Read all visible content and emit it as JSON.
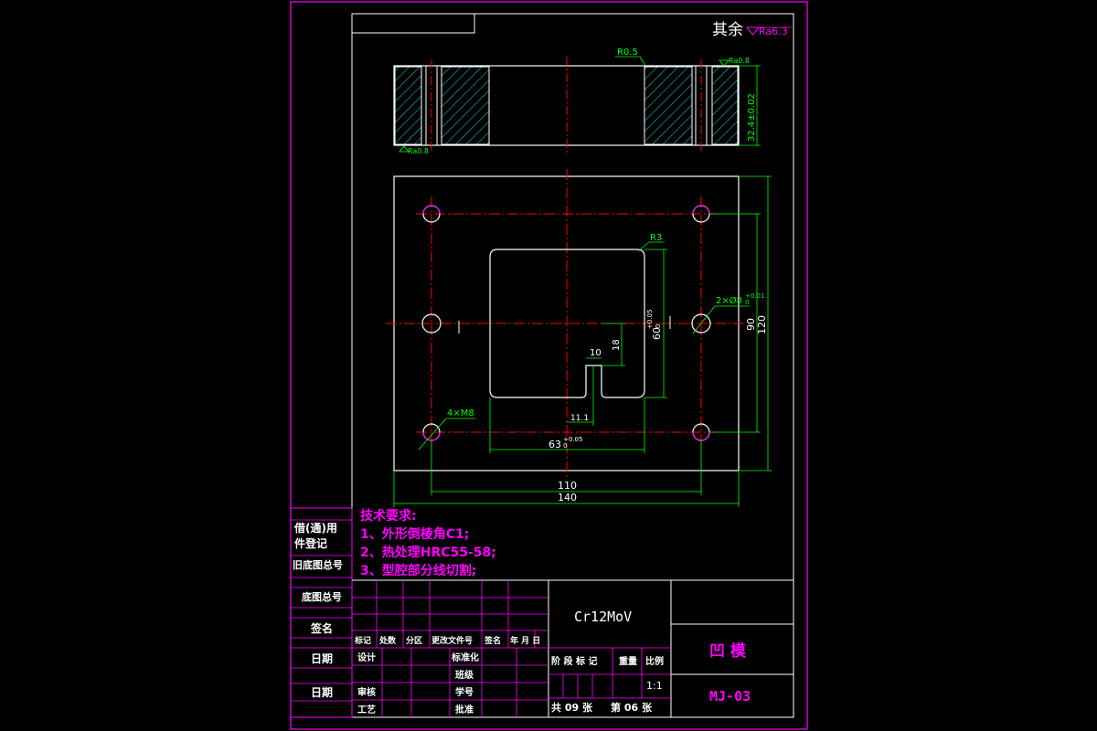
{
  "surface_note": {
    "text": "其余",
    "roughness": "Ra6.3"
  },
  "front_view": {
    "fillet_label": "R0.5",
    "thickness_dim": "32.4±0.02",
    "roughness_top": "Ra0.8",
    "roughness_bottom": "Ra0.8"
  },
  "plan_view": {
    "pocket_fillet": "R3",
    "hole_callout": "2×Ø8",
    "hole_tol": "+0.01",
    "hole_tol_low": "0",
    "tapped_holes": "4×M8",
    "dim_60": "60",
    "dim_60_tol": "+0.05",
    "dim_60_tol_low": "0",
    "dim_63": "63",
    "dim_63_tol": "+0.05",
    "dim_63_tol_low": "0",
    "dim_10": "10",
    "dim_18": "18",
    "dim_11_1": "11.1",
    "dim_90": "90",
    "dim_120": "120",
    "dim_110": "110",
    "dim_140": "140"
  },
  "tech_requirements": {
    "title": "技术要求:",
    "items": [
      "1、外形倒棱角C1;",
      "2、热处理HRC55-58;",
      "3、型腔部分线切割;"
    ]
  },
  "side_column": [
    "借(通)用",
    "件登记",
    "旧底图总号",
    "底图总号",
    "签名",
    "日期",
    "日期"
  ],
  "title_block": {
    "material": "Cr12MoV",
    "part_name": "凹 模",
    "drawing_no": "MJ-03",
    "rev_headers": [
      "标记",
      "处数",
      "分区",
      "更改文件号",
      "签名",
      "年 月 日"
    ],
    "row_design": "设计",
    "row_standard": "标准化",
    "row_class": "班级",
    "row_student_no": "学号",
    "row_review": "审核",
    "row_process": "工艺",
    "row_approve": "批准",
    "stage_headers": [
      "阶 段 标 记",
      "重量",
      "比例"
    ],
    "scale": "1:1",
    "sheets_total": "共 09 张",
    "sheet_no": "第 06 张"
  },
  "colors": {
    "frame": "#ff00ff",
    "part": "#ffffff",
    "dimension": "#00ff00",
    "centerline": "#ff0000",
    "hatch": "#00ffff",
    "text_magenta": "#ff00ff"
  }
}
